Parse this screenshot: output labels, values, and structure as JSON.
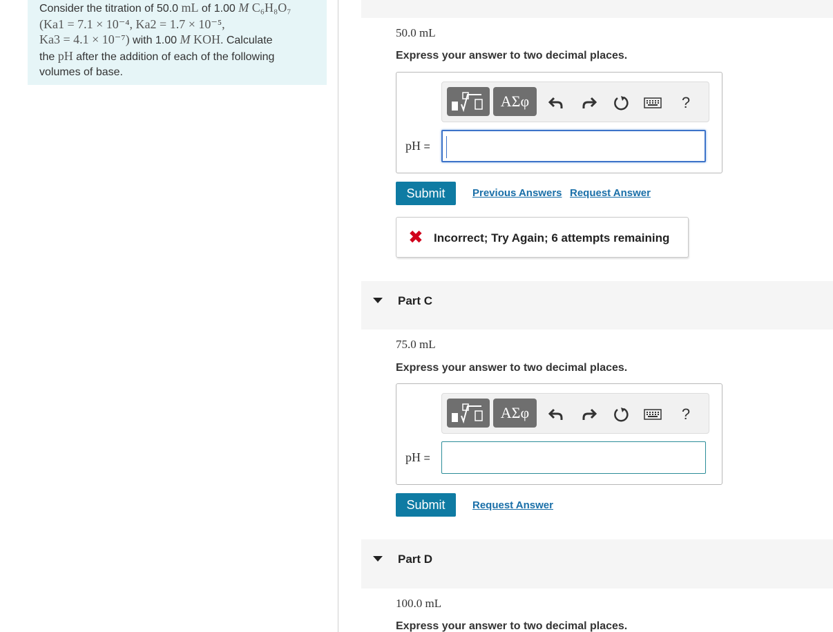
{
  "problem": {
    "line1_text_a": "Consider the titration of 50.0 ",
    "line1_unit_mL": "mL",
    "line1_text_b": " of 1.00 ",
    "line1_M": "M",
    "line1_formula": "C₆H₈O₇",
    "line2": "(Ka1 = 7.1 × 10⁻⁴, Ka2 = 1.7 × 10⁻⁵,",
    "line3_math": "Ka3 = 4.1 × 10⁻⁷)",
    "line3_text": " with 1.00 ",
    "line3_M": "M",
    "line3_base": "KOH",
    "line3_tail": ". Calculate",
    "line4_a": "the ",
    "line4_pH": "pH",
    "line4_b": " after the addition of each of the following",
    "line5": "volumes of base."
  },
  "part_b": {
    "volume": "50.0 mL",
    "instruction": "Express your answer to two decimal places.",
    "ph_label": "pH",
    "eq": "=",
    "input_value": "",
    "submit_label": "Submit",
    "previous_answers_label": "Previous Answers",
    "request_answer_label": "Request Answer",
    "feedback_icon": "✖",
    "feedback_text": "Incorrect; Try Again; 6 attempts remaining"
  },
  "part_c": {
    "title": "Part C",
    "volume": "75.0 mL",
    "instruction": "Express your answer to two decimal places.",
    "ph_label": "pH",
    "eq": "=",
    "input_value": "",
    "submit_label": "Submit",
    "request_answer_label": "Request Answer"
  },
  "part_d": {
    "title": "Part D",
    "volume": "100.0 mL",
    "instruction": "Express your answer to two decimal places."
  },
  "toolbar": {
    "greek_label": "ΑΣφ",
    "help_label": "?",
    "icons": [
      "templates-icon",
      "greek-symbols-icon",
      "undo-icon",
      "redo-icon",
      "reset-icon",
      "keyboard-icon",
      "help-icon"
    ]
  },
  "colors": {
    "submit_bg": "#0f7ba3",
    "link": "#1a6fa8",
    "error": "#d0021b",
    "problem_bg": "#e6f5f7"
  }
}
